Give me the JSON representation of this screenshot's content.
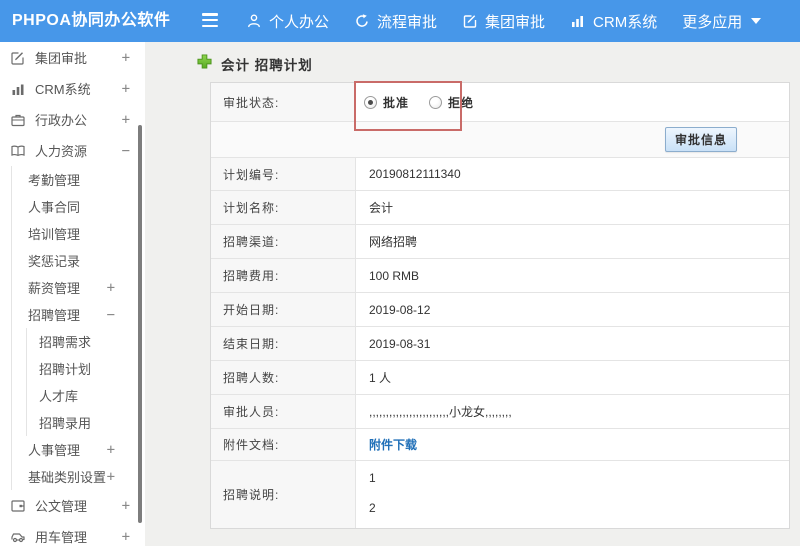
{
  "topbar": {
    "logo": "PHPOA协同办公软件",
    "nav": [
      {
        "label": "个人办公",
        "icon": "user-icon"
      },
      {
        "label": "流程审批",
        "icon": "cycle-icon"
      },
      {
        "label": "集团审批",
        "icon": "edit-icon"
      },
      {
        "label": "CRM系统",
        "icon": "bar-chart-icon"
      },
      {
        "label": "更多应用",
        "icon": "caret-down-icon"
      }
    ]
  },
  "sidebar": {
    "items": [
      {
        "label": "集团审批",
        "expand": "+"
      },
      {
        "label": "CRM系统",
        "expand": "+"
      },
      {
        "label": "行政办公",
        "expand": "+"
      },
      {
        "label": "人力资源",
        "expand": "−"
      },
      {
        "label": "考勤管理"
      },
      {
        "label": "人事合同"
      },
      {
        "label": "培训管理"
      },
      {
        "label": "奖惩记录"
      },
      {
        "label": "薪资管理",
        "expand": "+"
      },
      {
        "label": "招聘管理",
        "expand": "−"
      },
      {
        "label": "招聘需求"
      },
      {
        "label": "招聘计划"
      },
      {
        "label": "人才库"
      },
      {
        "label": "招聘录用"
      },
      {
        "label": "人事管理",
        "expand": "+"
      },
      {
        "label": "基础类别设置",
        "expand": "+"
      },
      {
        "label": "公文管理",
        "expand": "+"
      },
      {
        "label": "用车管理",
        "expand": "+"
      }
    ]
  },
  "main": {
    "title": "会计 招聘计划",
    "approval": {
      "label": "审批状态:",
      "options": [
        {
          "label": "批准",
          "selected": true
        },
        {
          "label": "拒绝",
          "selected": false
        }
      ],
      "button_label": "审批信息"
    },
    "fields": [
      {
        "label": "计划编号:",
        "value": "20190812111340"
      },
      {
        "label": "计划名称:",
        "value": "会计"
      },
      {
        "label": "招聘渠道:",
        "value": "网络招聘"
      },
      {
        "label": "招聘费用:",
        "value": "100 RMB"
      },
      {
        "label": "开始日期:",
        "value": "2019-08-12"
      },
      {
        "label": "结束日期:",
        "value": "2019-08-31"
      },
      {
        "label": "招聘人数:",
        "value": "1 人"
      },
      {
        "label": "审批人员:",
        "value": ",,,,,,,,,,,,,,,,,,,,,,,,小龙女,,,,,,,,"
      },
      {
        "label": "附件文档:",
        "link_label": "附件下载"
      },
      {
        "label": "招聘说明:",
        "lines": [
          "1",
          "2"
        ]
      }
    ],
    "colors": {
      "topbar_blue": "#4797e9",
      "annotation_red": "#c96b68",
      "link_blue": "#2170b8",
      "add_icon_green": "#6ec32f"
    }
  }
}
